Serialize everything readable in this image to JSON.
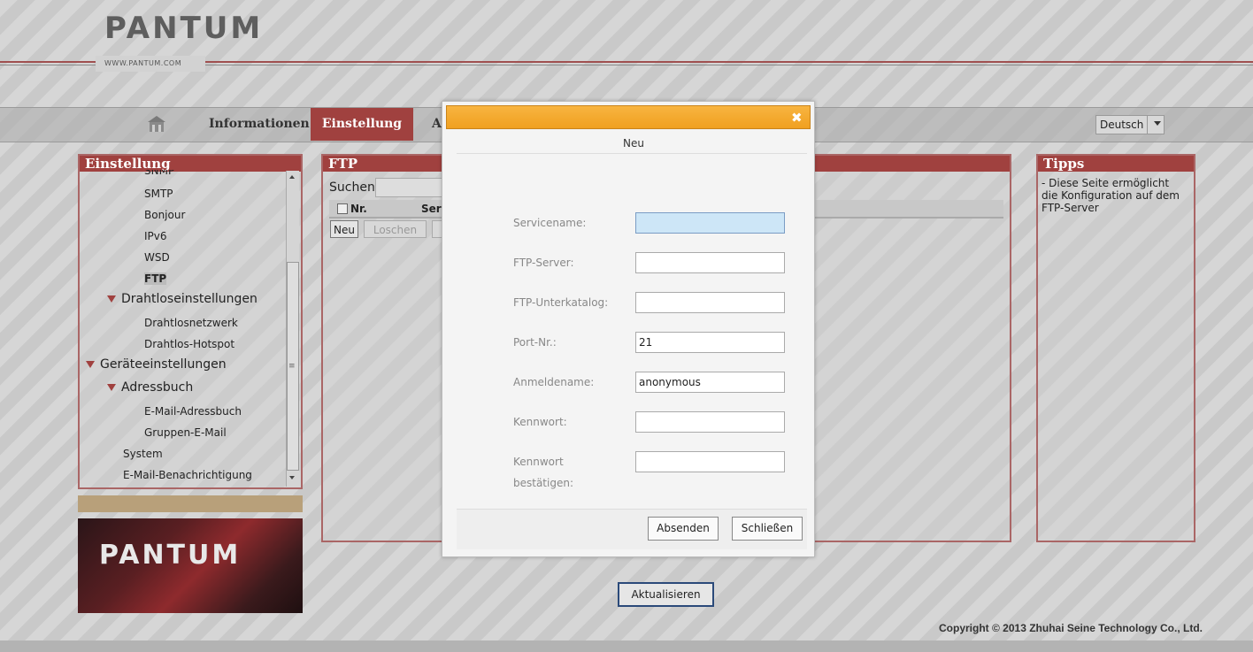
{
  "header": {
    "logo": "PANTUM",
    "url": "WWW.PANTUM.COM"
  },
  "nav": {
    "home_icon": "home-icon",
    "items": [
      "Informationen",
      "Einstellung",
      "A"
    ],
    "active": "Einstellung",
    "language": "Deutsch"
  },
  "left_panel": {
    "title": "Einstellung",
    "tree": {
      "snmp": "SNMP",
      "smtp": "SMTP",
      "bonjour": "Bonjour",
      "ipv6": "IPv6",
      "wsd": "WSD",
      "ftp": "FTP",
      "wireless_group": "Drahtloseinstellungen",
      "wireless_net": "Drahtlosnetzwerk",
      "wireless_hotspot": "Drahtlos-Hotspot",
      "device_group": "Geräteeinstellungen",
      "addressbook_group": "Adressbuch",
      "email_addressbook": "E-Mail-Adressbuch",
      "group_email": "Gruppen-E-Mail",
      "system": "System",
      "email_notify": "E-Mail-Benachrichtigung"
    },
    "logo": "PANTUM"
  },
  "mid_panel": {
    "title": "FTP",
    "search_label": "Suchen",
    "columns": [
      "Nr.",
      "Serv"
    ],
    "buttons": {
      "new": "Neu",
      "delete": "Loschen"
    }
  },
  "right_panel": {
    "title": "Tipps",
    "text": "- Diese Seite ermöglicht die Konfiguration auf dem FTP-Server"
  },
  "refresh_label": "Aktualisieren",
  "copyright": "Copyright © 2013 Zhuhai Seine Technology Co., Ltd.",
  "dialog": {
    "close_icon": "close-icon",
    "heading": "Neu",
    "fields": {
      "service_label": "Servicename:",
      "service_value": "",
      "server_label": "FTP-Server:",
      "server_value": "",
      "subdir_label": "FTP-Unterkatalog:",
      "subdir_value": "",
      "port_label": "Port-Nr.:",
      "port_value": "21",
      "login_label": "Anmeldename:",
      "login_value": "anonymous",
      "password_label": "Kennwort:",
      "password_value": "",
      "confirm_label_1": "Kennwort",
      "confirm_label_2": "bestätigen:",
      "confirm_value": ""
    },
    "submit": "Absenden",
    "close": "Schließen"
  }
}
